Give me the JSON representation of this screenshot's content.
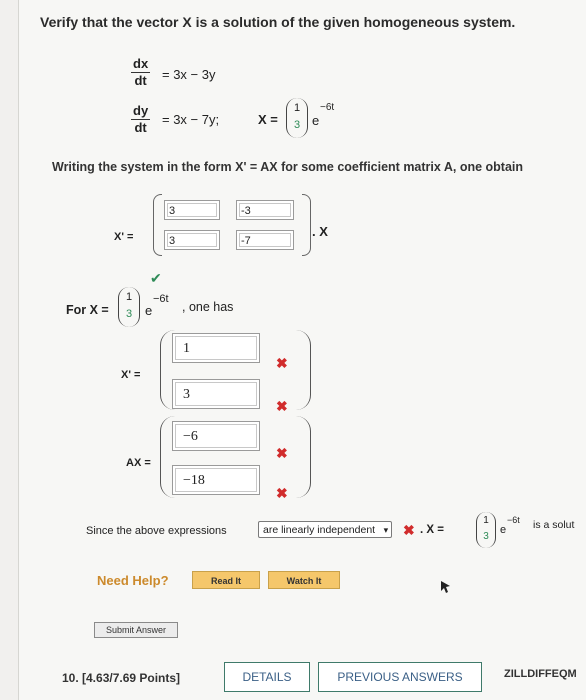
{
  "question": {
    "prompt": "Verify that the vector X is a solution of the given homogeneous system.",
    "eq1_rhs": "= 3x − 3y",
    "eq2_rhs": "= 3x − 7y;",
    "dx": "dx",
    "dt": "dt",
    "dy": "dy",
    "x_label": "X =",
    "vec_top": "1",
    "vec_bottom": "3",
    "exp": "e",
    "exp_power": "−6t",
    "writing_text_a": "Writing the system in the form ",
    "writing_text_b": "X' = AX",
    "writing_text_c": " for some coefficient matrix ",
    "writing_text_d": "A",
    "writing_text_e": ", one obtain"
  },
  "matrix": {
    "label": "X' =",
    "cells": [
      "3",
      "-3",
      "3",
      "-7"
    ],
    "suffix": ". X"
  },
  "for_x": {
    "prefix": "For X =",
    "vec_top": "1",
    "vec_bottom": "3",
    "exp": "e",
    "exp_power": "−6t",
    "suffix": ", one has",
    "checkmark": "✔"
  },
  "xprime": {
    "label": "X' =",
    "values": [
      "1",
      "3"
    ]
  },
  "ax": {
    "label": "AX =",
    "values": [
      "−6",
      "−18"
    ]
  },
  "marks": {
    "x": "✖"
  },
  "conclusion": {
    "text_a": "Since the above expressions",
    "select_value": "are linearly independent",
    "text_b": ". X =",
    "vec_top": "1",
    "vec_bottom": "3",
    "exp": "e",
    "exp_power": "−6t",
    "text_c": "is a solut"
  },
  "help": {
    "label": "Need Help?",
    "read_it": "Read It",
    "watch_it": "Watch It"
  },
  "submit_label": "Submit Answer",
  "footer": {
    "points": "10.  [4.63/7.69 Points]",
    "details": "DETAILS",
    "previous": "PREVIOUS ANSWERS",
    "course": "ZILLDIFFEQM"
  },
  "colors": {
    "correct": "#2e8b57",
    "incorrect": "#d12c2c",
    "help": "#cc8a2c",
    "button": "#f5c76b"
  }
}
